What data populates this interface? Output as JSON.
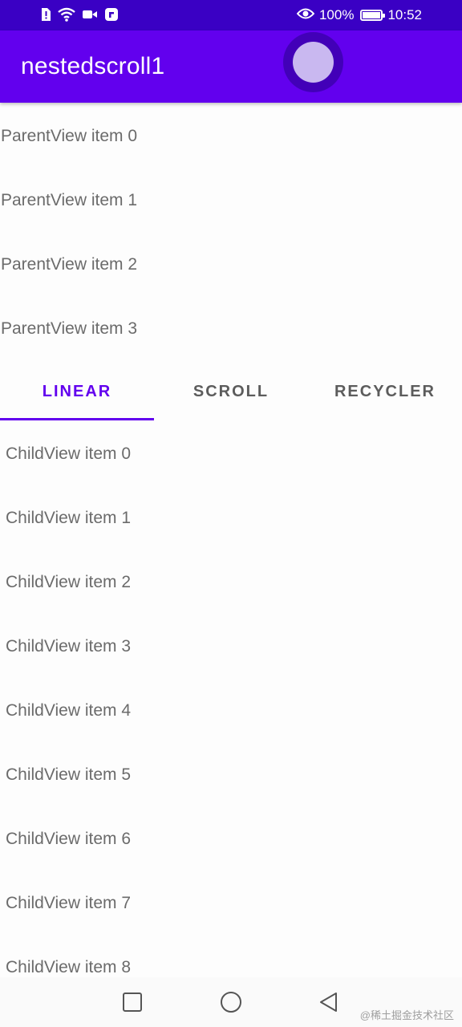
{
  "status_bar": {
    "battery": "100%",
    "time": "10:52",
    "battery_level": 1.0,
    "color": "#3a00c4"
  },
  "app_bar": {
    "title": "nestedscroll1",
    "color": "#6200ee"
  },
  "parent_items": [
    "ParentView item 0",
    "ParentView item 1",
    "ParentView item 2",
    "ParentView item 3"
  ],
  "tabs": [
    {
      "label": "LINEAR",
      "active": true
    },
    {
      "label": "SCROLL",
      "active": false
    },
    {
      "label": "RECYCLER",
      "active": false
    }
  ],
  "child_items": [
    "ChildView item 0",
    "ChildView item 1",
    "ChildView item 2",
    "ChildView item 3",
    "ChildView item 4",
    "ChildView item 5",
    "ChildView item 6",
    "ChildView item 7",
    "ChildView item 8"
  ],
  "nav_bar": {
    "icons": [
      "recents-square-icon",
      "home-circle-icon",
      "back-triangle-icon"
    ]
  },
  "watermark": "@稀土掘金技术社区"
}
